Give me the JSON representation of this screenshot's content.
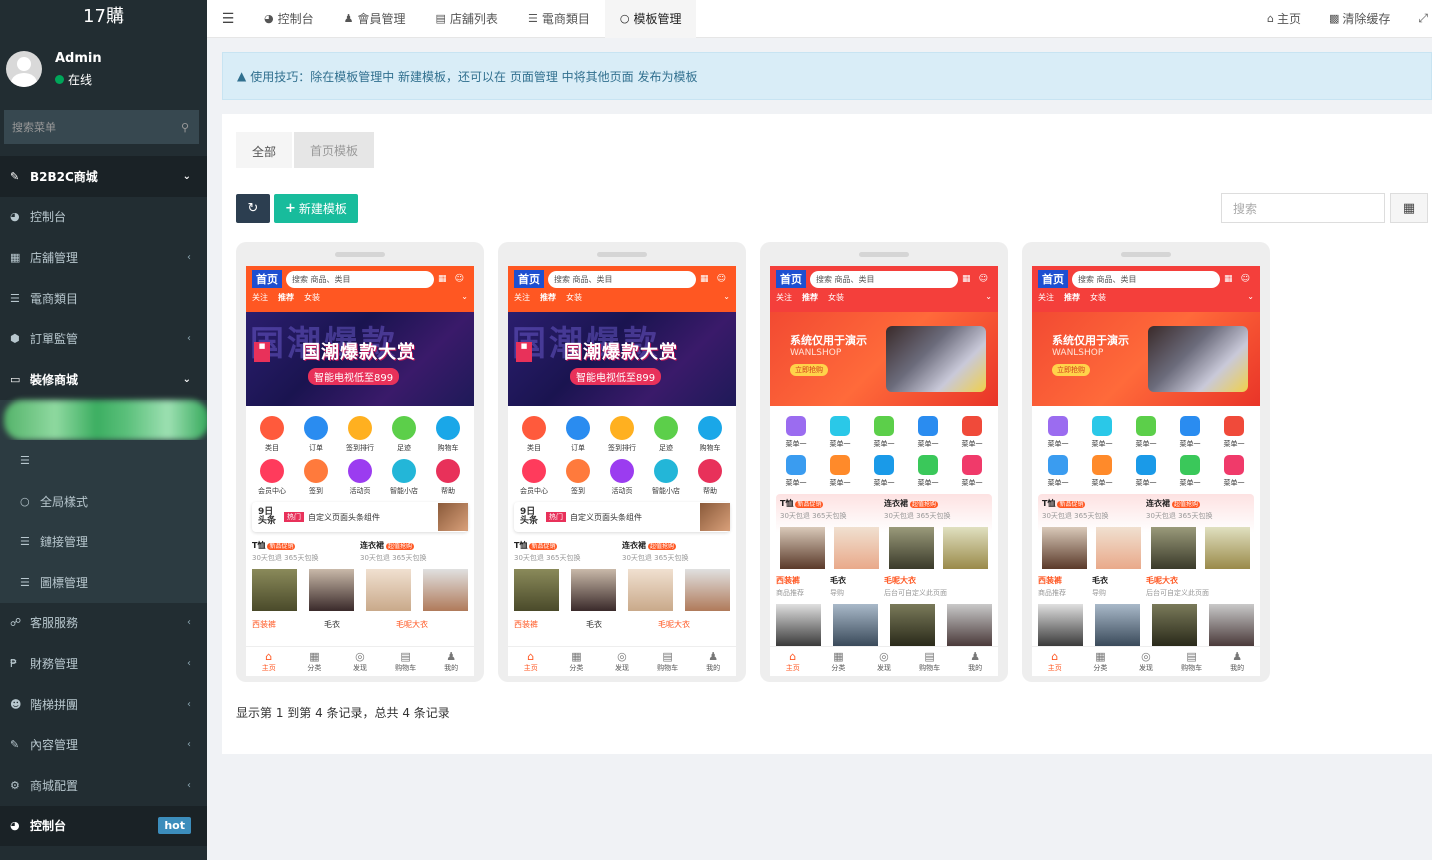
{
  "brand": "17購",
  "user": {
    "name": "Admin",
    "status": "在线"
  },
  "sidebar": {
    "search_placeholder": "搜索菜单",
    "items": [
      {
        "label": "B2B2C商城",
        "icon": "wrench-icon"
      },
      {
        "label": "控制台",
        "icon": "dashboard-icon"
      },
      {
        "label": "店舖管理",
        "icon": "store-icon"
      },
      {
        "label": "電商類目",
        "icon": "list-icon"
      },
      {
        "label": "訂單監管",
        "icon": "order-icon"
      },
      {
        "label": "裝修商城",
        "icon": "desktop-icon"
      },
      {
        "label": "全局樣式",
        "icon": "circle-icon"
      },
      {
        "label": "鏈接管理",
        "icon": "link-icon"
      },
      {
        "label": "圖標管理",
        "icon": "image-icon"
      },
      {
        "label": "客服服務",
        "icon": "chat-icon"
      },
      {
        "label": "財務管理",
        "icon": "money-icon"
      },
      {
        "label": "階梯拼團",
        "icon": "group-icon"
      },
      {
        "label": "內容管理",
        "icon": "edit-icon"
      },
      {
        "label": "商城配置",
        "icon": "gear-icon"
      },
      {
        "label": "控制台",
        "icon": "dashboard-icon",
        "badge": "hot"
      }
    ]
  },
  "topnav": {
    "tabs": [
      {
        "label": "控制台"
      },
      {
        "label": "會員管理"
      },
      {
        "label": "店舖列表"
      },
      {
        "label": "電商類目"
      },
      {
        "label": "模板管理"
      }
    ],
    "home": "主页",
    "clear_cache": "清除缓存"
  },
  "tip": "使用技巧：除在模板管理中 新建模板，还可以在 页面管理 中将其他页面 发布为模板",
  "panel": {
    "tabs": [
      "全部",
      "首页模板"
    ],
    "add_button": "新建模板",
    "search_placeholder": "搜索",
    "pager": "显示第 1 到第 4 条记录，总共 4 条记录"
  },
  "phone": {
    "home": "首页",
    "search": "搜索 商品、类目",
    "subnav": [
      "关注",
      "推荐",
      "女装"
    ],
    "dark_banner": {
      "title": "国潮爆款大赏",
      "subtitle": "智能电视低至899"
    },
    "red_banner": {
      "title": "系统仅用于演示",
      "subtitle": "WANLSHOP",
      "button": "立即抢购"
    },
    "grid_dark": [
      "类目",
      "订单",
      "签到排行",
      "足迹",
      "购物车",
      "会员中心",
      "签到",
      "活动页",
      "智能小店",
      "帮助"
    ],
    "grid_red_label": "菜单一",
    "notice": {
      "logo": "9日头条",
      "badge": "热门",
      "text": "自定义页面头条组件"
    },
    "goods": [
      {
        "title": "T恤",
        "badge": "新品促销",
        "sub": "30天包退 365天包换"
      },
      {
        "title": "连衣裙",
        "badge": "超值抢购",
        "sub": "30天包退 365天包换"
      }
    ],
    "cats": [
      "西装裤",
      "毛衣",
      "毛呢大衣"
    ],
    "red_cats": [
      {
        "title": "西装裤",
        "sub": "商品推荐"
      },
      {
        "title": "毛衣",
        "sub": "导购"
      },
      {
        "title": "毛呢大衣",
        "sub": "后台可自定义此页面"
      }
    ],
    "bottom": [
      "主页",
      "分类",
      "发现",
      "购物车",
      "我的"
    ]
  }
}
